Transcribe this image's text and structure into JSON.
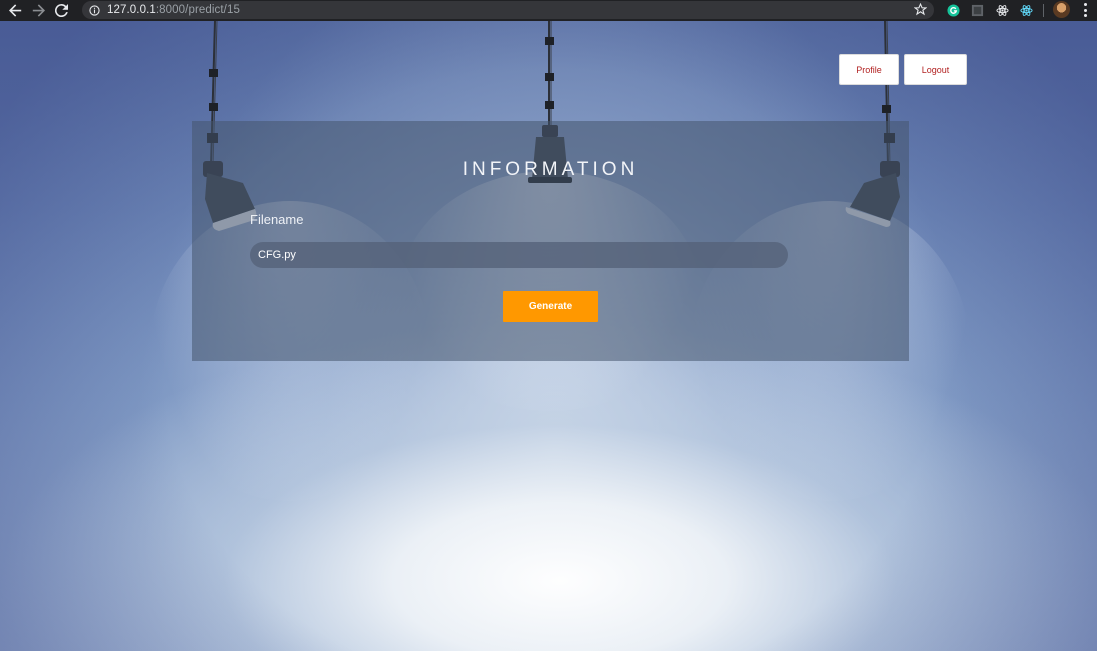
{
  "browser": {
    "url_host": "127.0.0.1",
    "url_rest": ":8000/predict/15"
  },
  "header": {
    "profile_label": "Profile",
    "logout_label": "Logout"
  },
  "panel": {
    "title": "INFORMATION",
    "field_label": "Filename",
    "field_value": "CFG.py",
    "generate_label": "Generate"
  },
  "colors": {
    "accent": "#ff9800",
    "link_text": "#b22222"
  }
}
